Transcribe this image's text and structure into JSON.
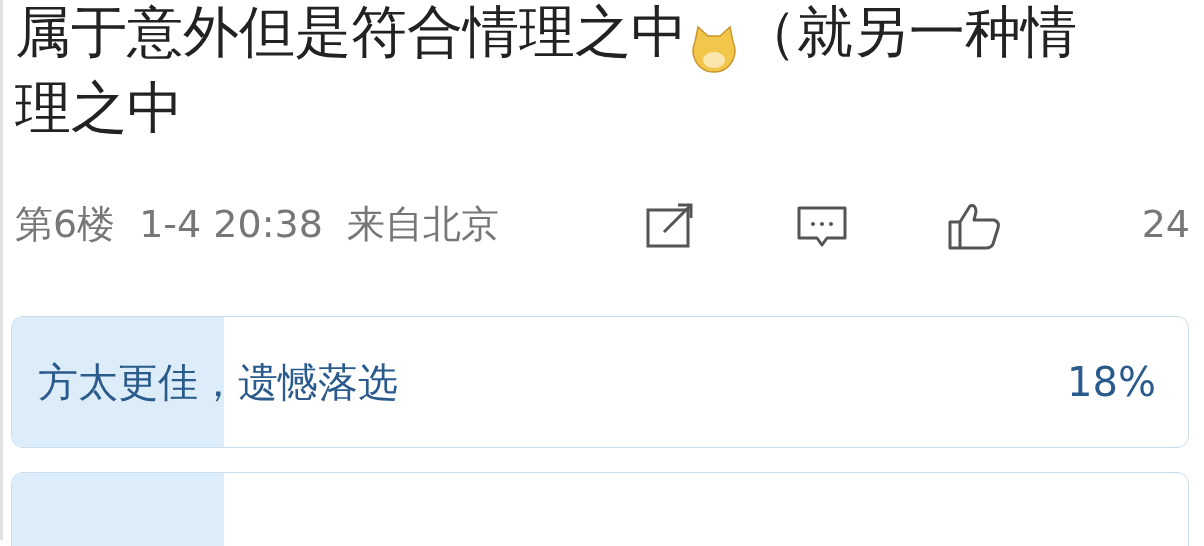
{
  "comment": {
    "line_1_before_emoji": "属于意外但是符合情理之中",
    "line_1_after_emoji": "（就另一种情",
    "line_2": "理之中"
  },
  "meta": {
    "floor": "第6楼",
    "time": "1-4 20:38",
    "location": "来自北京",
    "likes": "24"
  },
  "poll": {
    "options": [
      {
        "label": "方太更佳，遗憾落选",
        "percent": "18%",
        "level": 0.18
      },
      {
        "level": 0.18
      }
    ]
  }
}
